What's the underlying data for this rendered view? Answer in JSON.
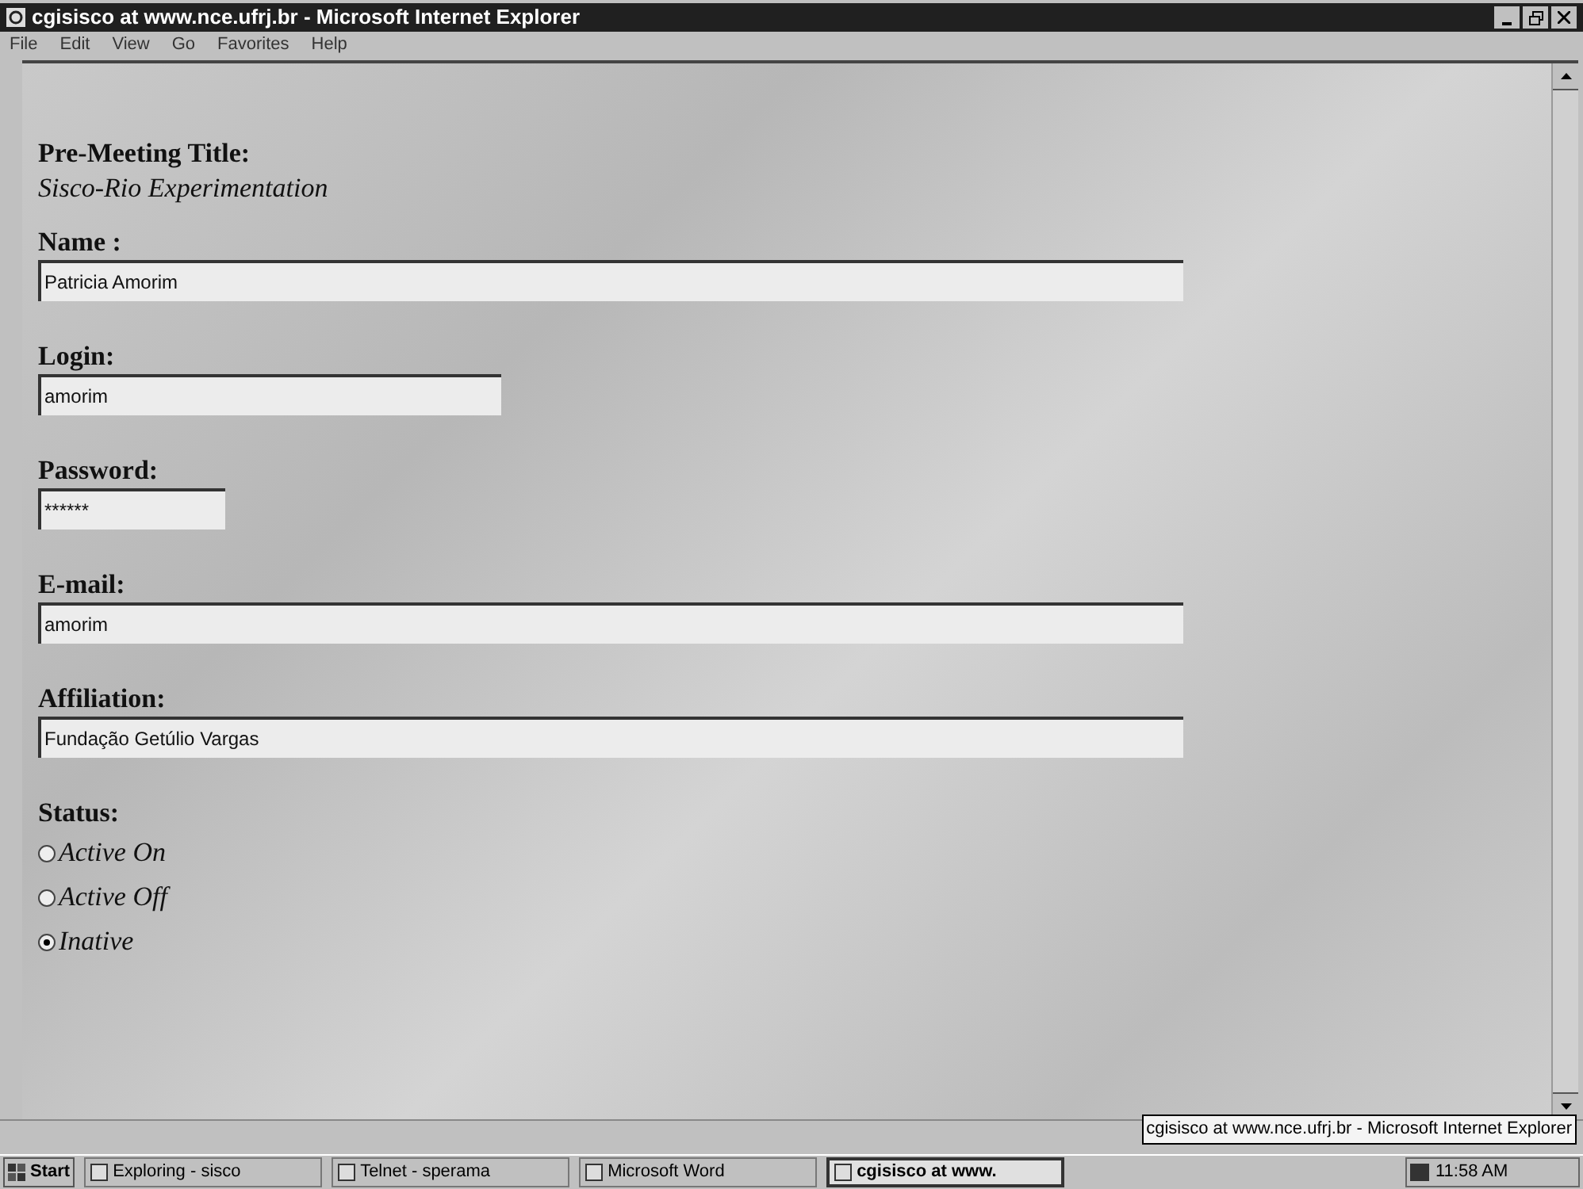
{
  "window": {
    "title": "cgisisco at www.nce.ufrj.br - Microsoft Internet Explorer"
  },
  "menu": [
    "File",
    "Edit",
    "View",
    "Go",
    "Favorites",
    "Help"
  ],
  "page": {
    "title_label": "Pre-Meeting Title:",
    "title_value": "Sisco-Rio Experimentation",
    "fields": [
      {
        "label": "Name :",
        "value": "Patricia Amorim"
      },
      {
        "label": "Login:",
        "value": "amorim"
      },
      {
        "label": "Password:",
        "value": "******"
      },
      {
        "label": "E-mail:",
        "value": "amorim"
      },
      {
        "label": "Affiliation:",
        "value": "Fundação Getúlio Vargas"
      }
    ],
    "status_label": "Status:",
    "status_options": [
      {
        "label": "Active On",
        "selected": false
      },
      {
        "label": "Active Off",
        "selected": false
      },
      {
        "label": "Inative",
        "selected": true
      }
    ]
  },
  "tooltip": "cgisisco at www.nce.ufrj.br - Microsoft Internet Explorer",
  "taskbar": {
    "start": "Start",
    "tasks": [
      {
        "label": "Exploring - sisco",
        "selected": false
      },
      {
        "label": "Telnet - sperama",
        "selected": false
      },
      {
        "label": "Microsoft Word",
        "selected": false
      },
      {
        "label": "cgisisco at www.",
        "selected": true
      }
    ],
    "clock": "11:58 AM"
  }
}
